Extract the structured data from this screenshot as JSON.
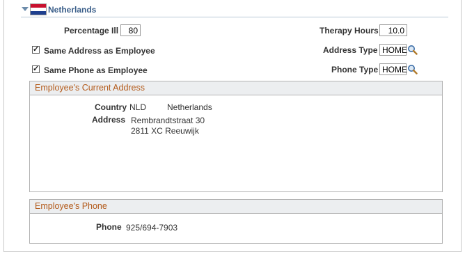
{
  "section": {
    "title": "Netherlands",
    "flag_icon": "netherlands-flag-icon",
    "colors": {
      "title": "#3b5f8a",
      "box_title": "#b35a1a"
    }
  },
  "fields": {
    "percentage_label": "Percentage Ill",
    "percentage_value": "80",
    "therapy_hours_label": "Therapy Hours",
    "therapy_hours_value": "10.0",
    "same_address_label": "Same Address as Employee",
    "same_address_checked": true,
    "same_phone_label": "Same Phone as Employee",
    "same_phone_checked": true,
    "address_type_label": "Address Type",
    "address_type_value": "HOME",
    "phone_type_label": "Phone Type",
    "phone_type_value": "HOME"
  },
  "address_box": {
    "title": "Employee's Current Address",
    "country_label": "Country",
    "country_code": "NLD",
    "country_name": "Netherlands",
    "address_label": "Address",
    "address_line1": "Rembrandtstraat 30",
    "address_line2": "2811 XC Reeuwijk"
  },
  "phone_box": {
    "title": "Employee's Phone",
    "phone_label": "Phone",
    "phone_value": "925/694-7903"
  }
}
